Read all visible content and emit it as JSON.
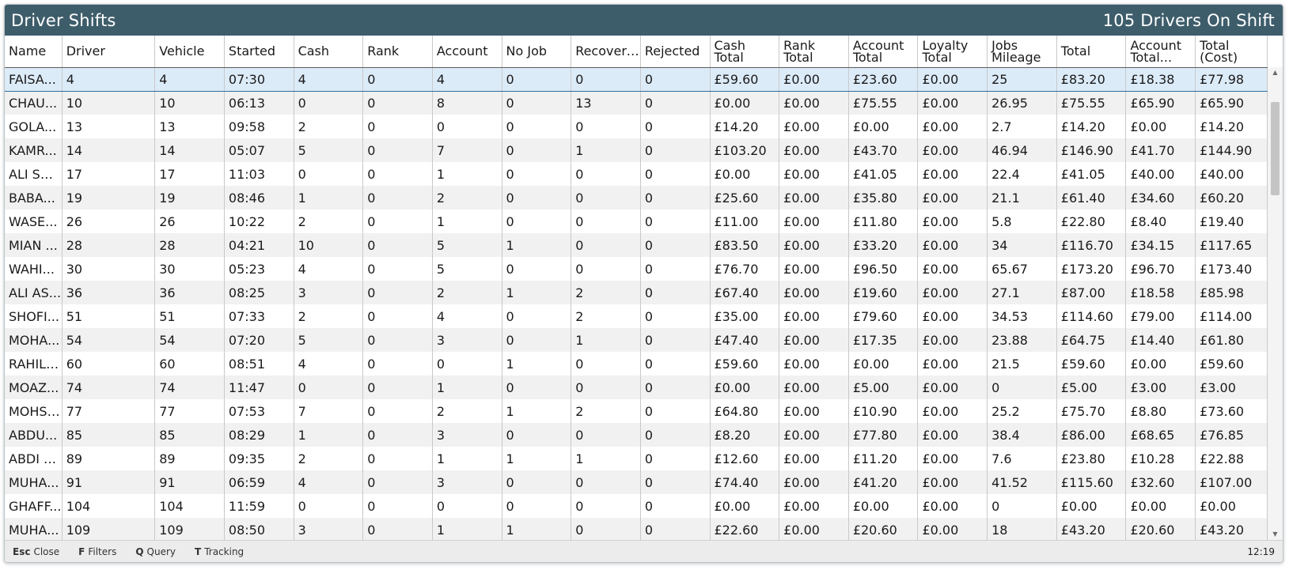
{
  "window": {
    "title": "Driver Shifts",
    "summary": "105 Drivers On Shift"
  },
  "columns": [
    "Name",
    "Driver",
    "Vehicle",
    "Started",
    "Cash",
    "Rank",
    "Account",
    "No Job",
    "Recovered",
    "Rejected",
    "Cash Total",
    "Rank Total",
    "Account Total",
    "Loyalty Total",
    "Jobs Mileage",
    "Total",
    "Account Total...",
    "Total (Cost)"
  ],
  "rows": [
    [
      "FAISA...",
      "4",
      "4",
      "07:30",
      "4",
      "0",
      "4",
      "0",
      "0",
      "0",
      "£59.60",
      "£0.00",
      "£23.60",
      "£0.00",
      "25",
      "£83.20",
      "£18.38",
      "£77.98"
    ],
    [
      "CHAU...",
      "10",
      "10",
      "06:13",
      "0",
      "0",
      "8",
      "0",
      "13",
      "0",
      "£0.00",
      "£0.00",
      "£75.55",
      "£0.00",
      "26.95",
      "£75.55",
      "£65.90",
      "£65.90"
    ],
    [
      "GOLA...",
      "13",
      "13",
      "09:58",
      "2",
      "0",
      "0",
      "0",
      "0",
      "0",
      "£14.20",
      "£0.00",
      "£0.00",
      "£0.00",
      "2.7",
      "£14.20",
      "£0.00",
      "£14.20"
    ],
    [
      "KAMR...",
      "14",
      "14",
      "05:07",
      "5",
      "0",
      "7",
      "0",
      "1",
      "0",
      "£103.20",
      "£0.00",
      "£43.70",
      "£0.00",
      "46.94",
      "£146.90",
      "£41.70",
      "£144.90"
    ],
    [
      "ALI SH...",
      "17",
      "17",
      "11:03",
      "0",
      "0",
      "1",
      "0",
      "0",
      "0",
      "£0.00",
      "£0.00",
      "£41.05",
      "£0.00",
      "22.4",
      "£41.05",
      "£40.00",
      "£40.00"
    ],
    [
      "BABA...",
      "19",
      "19",
      "08:46",
      "1",
      "0",
      "2",
      "0",
      "0",
      "0",
      "£25.60",
      "£0.00",
      "£35.80",
      "£0.00",
      "21.1",
      "£61.40",
      "£34.60",
      "£60.20"
    ],
    [
      "WASE...",
      "26",
      "26",
      "10:22",
      "2",
      "0",
      "1",
      "0",
      "0",
      "0",
      "£11.00",
      "£0.00",
      "£11.80",
      "£0.00",
      "5.8",
      "£22.80",
      "£8.40",
      "£19.40"
    ],
    [
      "MIAN ...",
      "28",
      "28",
      "04:21",
      "10",
      "0",
      "5",
      "1",
      "0",
      "0",
      "£83.50",
      "£0.00",
      "£33.20",
      "£0.00",
      "34",
      "£116.70",
      "£34.15",
      "£117.65"
    ],
    [
      "WAHI...",
      "30",
      "30",
      "05:23",
      "4",
      "0",
      "5",
      "0",
      "0",
      "0",
      "£76.70",
      "£0.00",
      "£96.50",
      "£0.00",
      "65.67",
      "£173.20",
      "£96.70",
      "£173.40"
    ],
    [
      "ALI AS...",
      "36",
      "36",
      "08:25",
      "3",
      "0",
      "2",
      "1",
      "2",
      "0",
      "£67.40",
      "£0.00",
      "£19.60",
      "£0.00",
      "27.1",
      "£87.00",
      "£18.58",
      "£85.98"
    ],
    [
      "SHOFI...",
      "51",
      "51",
      "07:33",
      "2",
      "0",
      "4",
      "0",
      "2",
      "0",
      "£35.00",
      "£0.00",
      "£79.60",
      "£0.00",
      "34.53",
      "£114.60",
      "£79.00",
      "£114.00"
    ],
    [
      "MOHA...",
      "54",
      "54",
      "07:20",
      "5",
      "0",
      "3",
      "0",
      "1",
      "0",
      "£47.40",
      "£0.00",
      "£17.35",
      "£0.00",
      "23.88",
      "£64.75",
      "£14.40",
      "£61.80"
    ],
    [
      "RAHIL ...",
      "60",
      "60",
      "08:51",
      "4",
      "0",
      "0",
      "1",
      "0",
      "0",
      "£59.60",
      "£0.00",
      "£0.00",
      "£0.00",
      "21.5",
      "£59.60",
      "£0.00",
      "£59.60"
    ],
    [
      "MOAZ...",
      "74",
      "74",
      "11:47",
      "0",
      "0",
      "1",
      "0",
      "0",
      "0",
      "£0.00",
      "£0.00",
      "£5.00",
      "£0.00",
      "0",
      "£5.00",
      "£3.00",
      "£3.00"
    ],
    [
      "MOHSI...",
      "77",
      "77",
      "07:53",
      "7",
      "0",
      "2",
      "1",
      "2",
      "0",
      "£64.80",
      "£0.00",
      "£10.90",
      "£0.00",
      "25.2",
      "£75.70",
      "£8.80",
      "£73.60"
    ],
    [
      "ABDU...",
      "85",
      "85",
      "08:29",
      "1",
      "0",
      "3",
      "0",
      "0",
      "0",
      "£8.20",
      "£0.00",
      "£77.80",
      "£0.00",
      "38.4",
      "£86.00",
      "£68.65",
      "£76.85"
    ],
    [
      "ABDI K...",
      "89",
      "89",
      "09:35",
      "2",
      "0",
      "1",
      "1",
      "1",
      "0",
      "£12.60",
      "£0.00",
      "£11.20",
      "£0.00",
      "7.6",
      "£23.80",
      "£10.28",
      "£22.88"
    ],
    [
      "MUHA...",
      "91",
      "91",
      "06:59",
      "4",
      "0",
      "3",
      "0",
      "0",
      "0",
      "£74.40",
      "£0.00",
      "£41.20",
      "£0.00",
      "41.52",
      "£115.60",
      "£32.60",
      "£107.00"
    ],
    [
      "GHAFF...",
      "104",
      "104",
      "11:59",
      "0",
      "0",
      "0",
      "0",
      "0",
      "0",
      "£0.00",
      "£0.00",
      "£0.00",
      "£0.00",
      "0",
      "£0.00",
      "£0.00",
      "£0.00"
    ],
    [
      "MUHA...",
      "109",
      "109",
      "08:50",
      "3",
      "0",
      "1",
      "1",
      "0",
      "0",
      "£22.60",
      "£0.00",
      "£20.60",
      "£0.00",
      "18",
      "£43.20",
      "£20.60",
      "£43.20"
    ]
  ],
  "selected_row": 0,
  "footer": {
    "shortcuts": [
      {
        "key": "Esc",
        "label": "Close"
      },
      {
        "key": "F",
        "label": "Filters"
      },
      {
        "key": "Q",
        "label": "Query"
      },
      {
        "key": "T",
        "label": "Tracking"
      }
    ],
    "clock": "12:19"
  },
  "scrollbar": {
    "up_glyph": "▲",
    "down_glyph": "▼"
  }
}
